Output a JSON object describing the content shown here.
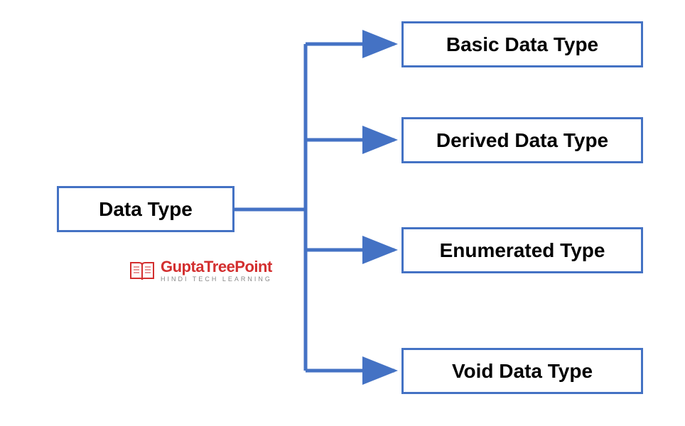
{
  "diagram": {
    "root": {
      "label": "Data Type"
    },
    "children": [
      {
        "label": "Basic Data Type"
      },
      {
        "label": "Derived Data Type"
      },
      {
        "label": "Enumerated Type"
      },
      {
        "label": "Void Data Type"
      }
    ]
  },
  "watermark": {
    "title": "GuptaTreePoint",
    "subtitle": "HINDI TECH LEARNING"
  },
  "colors": {
    "box_border": "#4472c4",
    "connector": "#4472c4",
    "watermark_title": "#d32f2f",
    "watermark_subtitle": "#888888"
  }
}
